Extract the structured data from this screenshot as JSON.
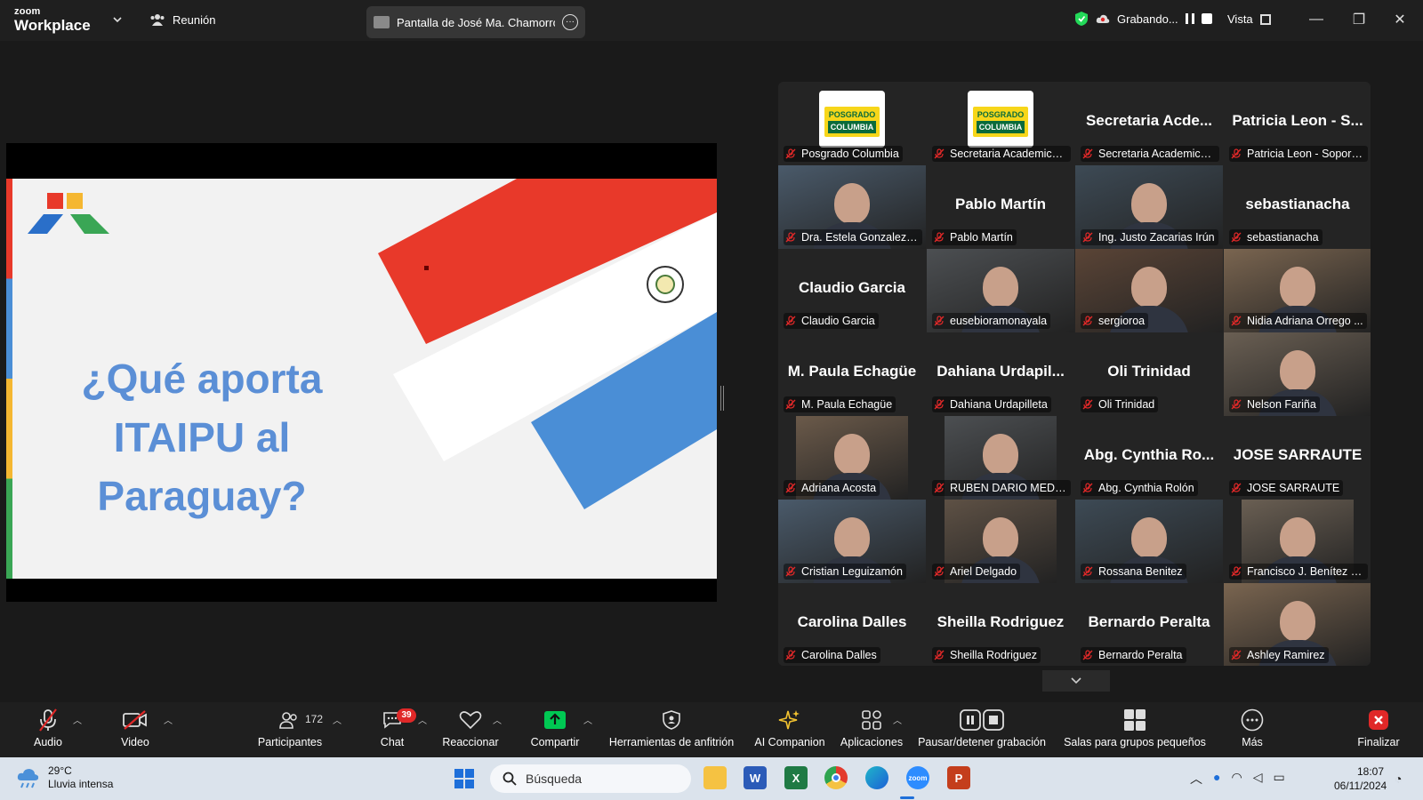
{
  "titlebar": {
    "brand_small": "zoom",
    "brand_large": "Workplace",
    "meeting_label": "Reunión",
    "share_label": "Pantalla de José Ma. Chamorro A",
    "recording_label": "Grabando...",
    "view_label": "Vista"
  },
  "slide": {
    "title_lines": [
      "¿Qué aporta",
      "ITAIPU al",
      "Paraguay?"
    ],
    "seal_text": "REPUBLICA DEL PARAGUAY"
  },
  "gallery": {
    "tiles": [
      {
        "name": "Posgrado Columbia",
        "big": "",
        "video": false,
        "logo": true
      },
      {
        "name": "Secretaria Academica -...",
        "big": "",
        "video": false,
        "logo": true
      },
      {
        "name": "Secretaria Academica - ...",
        "big": "Secretaria  Acde...",
        "video": false,
        "logo": false
      },
      {
        "name": "Patricia Leon - Soporte...",
        "big": "Patricia Leon - S...",
        "video": false,
        "logo": false
      },
      {
        "name": "Dra. Estela Gonzalez d...",
        "big": "",
        "video": true,
        "logo": false
      },
      {
        "name": "Pablo Martín",
        "big": "Pablo Martín",
        "video": false,
        "logo": false
      },
      {
        "name": "Ing. Justo Zacarias Irún",
        "big": "",
        "video": true,
        "logo": false
      },
      {
        "name": "sebastianacha",
        "big": "sebastianacha",
        "video": false,
        "logo": false
      },
      {
        "name": "Claudio Garcia",
        "big": "Claudio Garcia",
        "video": false,
        "logo": false
      },
      {
        "name": "eusebioramonayala",
        "big": "",
        "video": true,
        "logo": false
      },
      {
        "name": "sergioroa",
        "big": "",
        "video": true,
        "logo": false
      },
      {
        "name": "Nidia Adriana Orrego ...",
        "big": "",
        "video": true,
        "logo": false
      },
      {
        "name": "M. Paula Echagüe",
        "big": "M. Paula Echagüe",
        "video": false,
        "logo": false
      },
      {
        "name": "Dahiana Urdapilleta",
        "big": "Dahiana  Urdapil...",
        "video": false,
        "logo": false
      },
      {
        "name": "Oli Trinidad",
        "big": "Oli Trinidad",
        "video": false,
        "logo": false
      },
      {
        "name": "Nelson Fariña",
        "big": "",
        "video": true,
        "logo": false
      },
      {
        "name": "Adriana Acosta",
        "big": "",
        "video": true,
        "logo": false
      },
      {
        "name": "RUBEN DARIO MEDIN...",
        "big": "",
        "video": true,
        "logo": false
      },
      {
        "name": "Abg. Cynthia Rolón",
        "big": "Abg. Cynthia Ro...",
        "video": false,
        "logo": false
      },
      {
        "name": "JOSE SARRAUTE",
        "big": "JOSE SARRAUTE",
        "video": false,
        "logo": false
      },
      {
        "name": "Cristian Leguizamón",
        "big": "",
        "video": true,
        "logo": false
      },
      {
        "name": "Ariel Delgado",
        "big": "",
        "video": true,
        "logo": false
      },
      {
        "name": "Rossana Benitez",
        "big": "",
        "video": true,
        "logo": false
      },
      {
        "name": "Francisco J. Benítez del...",
        "big": "",
        "video": true,
        "logo": false
      },
      {
        "name": "Carolina Dalles",
        "big": "Carolina Dalles",
        "video": false,
        "logo": false
      },
      {
        "name": "Sheilla Rodriguez",
        "big": "Sheilla Rodriguez",
        "video": false,
        "logo": false
      },
      {
        "name": "Bernardo Peralta",
        "big": "Bernardo Peralta",
        "video": false,
        "logo": false
      },
      {
        "name": "Ashley Ramirez",
        "big": "",
        "video": true,
        "logo": false
      }
    ],
    "logo_line1": "POSGRADO",
    "logo_line2": "COLUMBIA",
    "active_tile": 6
  },
  "toolbar": {
    "audio": "Audio",
    "video": "Video",
    "participants": "Participantes",
    "participants_count": "172",
    "chat": "Chat",
    "chat_badge": "39",
    "react": "Reaccionar",
    "share": "Compartir",
    "host_tools": "Herramientas de anfitrión",
    "ai": "AI Companion",
    "apps": "Aplicaciones",
    "pause_rec": "Pausar/detener grabación",
    "breakout": "Salas para grupos pequeños",
    "more": "Más",
    "end": "Finalizar"
  },
  "taskbar": {
    "temp": "29°C",
    "weather": "Lluvia intensa",
    "search_placeholder": "Búsqueda",
    "time": "18:07",
    "date": "06/11/2024"
  },
  "colors": {
    "accent_green": "#23d959",
    "share_green": "#00c853",
    "end_red": "#e02828",
    "slide_title_blue": "#5b8fd6",
    "flag_red": "#e8392a",
    "flag_blue": "#4a8ed6"
  }
}
